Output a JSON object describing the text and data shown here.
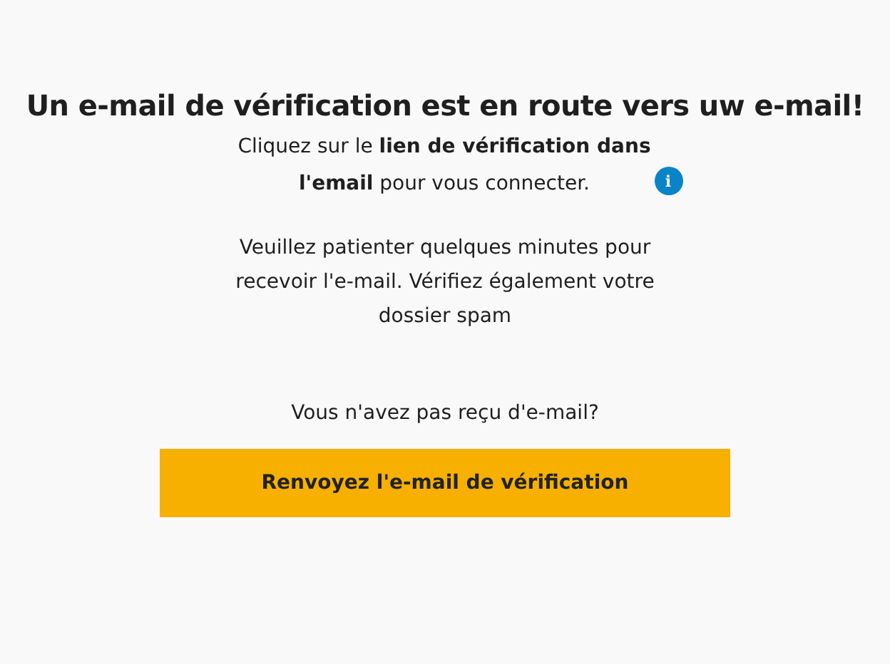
{
  "title": "Un e-mail de vérification est en route vers uw e-mail!",
  "instruction": "Cliquez sur le **lien de vérification dans l'email** pour vous connecter.",
  "info_icon": {
    "label": "i"
  },
  "wait_message": "Veuillez patienter quelques minutes pour recevoir l'e-mail. Vérifiez également votre dossier spam",
  "resend_prompt": "Vous n'avez pas reçu d'e-mail?",
  "resend_button": "Renvoyez l'e-mail de vérification"
}
